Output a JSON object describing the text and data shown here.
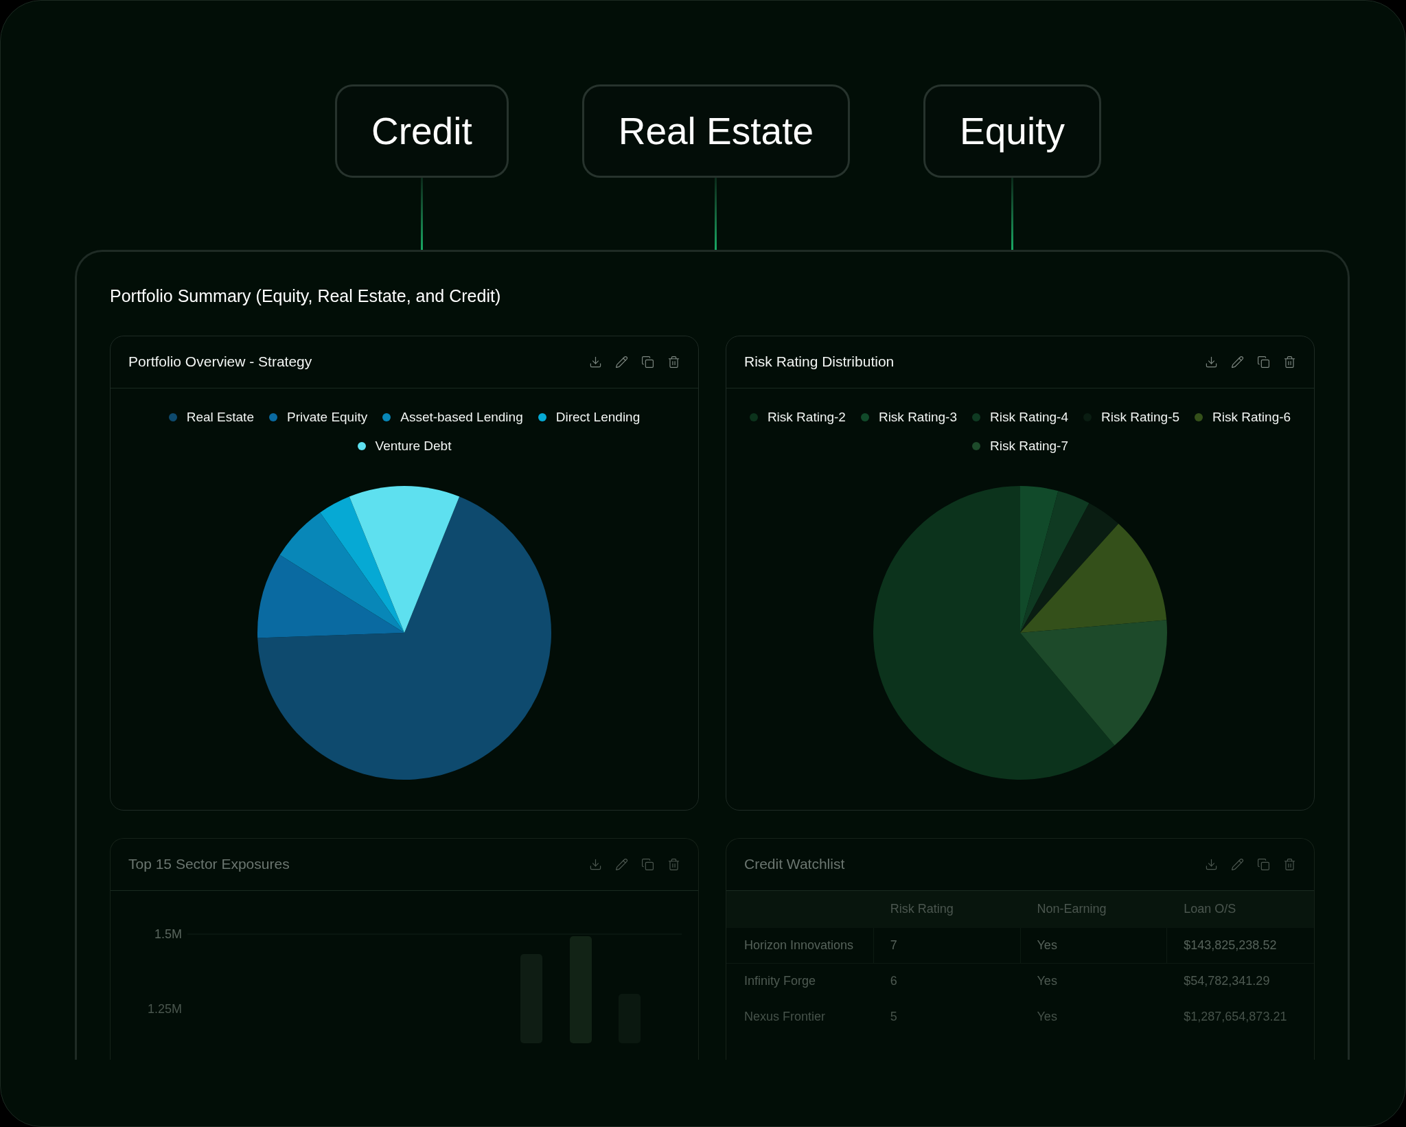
{
  "tabs": [
    {
      "label": "Credit"
    },
    {
      "label": "Real Estate"
    },
    {
      "label": "Equity"
    }
  ],
  "summary": {
    "title": "Portfolio Summary (Equity, Real Estate, and Credit)",
    "strategy_card": {
      "title": "Portfolio Overview - Strategy",
      "legend": [
        {
          "label": "Real Estate",
          "color": "#0e4a6e"
        },
        {
          "label": "Private Equity",
          "color": "#0a6aa1"
        },
        {
          "label": "Asset-based Lending",
          "color": "#0887b8"
        },
        {
          "label": "Direct Lending",
          "color": "#06a9d4"
        },
        {
          "label": "Venture Debt",
          "color": "#5ee0ef"
        }
      ]
    },
    "risk_card": {
      "title": "Risk Rating Distribution",
      "legend": [
        {
          "label": "Risk Rating-2",
          "color": "#0c331c"
        },
        {
          "label": "Risk Rating-3",
          "color": "#114a2a"
        },
        {
          "label": "Risk Rating-4",
          "color": "#0f3a22"
        },
        {
          "label": "Risk Rating-5",
          "color": "#0a1d12"
        },
        {
          "label": "Risk Rating-6",
          "color": "#34501a"
        },
        {
          "label": "Risk Rating-7",
          "color": "#1d4a2a"
        }
      ]
    },
    "sector_card": {
      "title": "Top 15 Sector Exposures",
      "y_labels": [
        "1.5M",
        "1.25M"
      ]
    },
    "watchlist_card": {
      "title": "Credit Watchlist",
      "columns": [
        "",
        "Risk Rating",
        "Non-Earning",
        "Loan O/S"
      ],
      "rows": [
        [
          "Horizon Innovations",
          "7",
          "Yes",
          "$143,825,238.52"
        ],
        [
          "Infinity Forge",
          "6",
          "Yes",
          "$54,782,341.29"
        ],
        [
          "Nexus Frontier",
          "5",
          "Yes",
          "$1,287,654,873.21"
        ]
      ]
    }
  }
}
